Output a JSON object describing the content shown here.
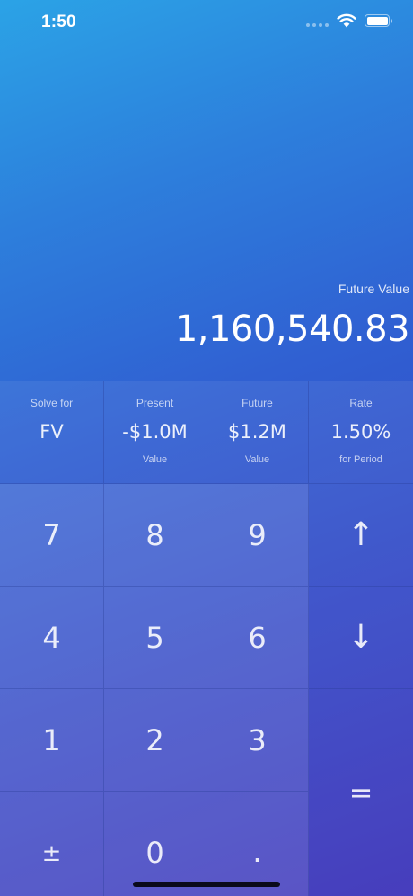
{
  "status_bar": {
    "time": "1:50",
    "icons": [
      "signal-icon",
      "wifi-icon",
      "battery-icon"
    ]
  },
  "display": {
    "label": "Future Value",
    "value": "1,160,540.83"
  },
  "variables": [
    {
      "top": "Solve for",
      "main": "FV",
      "bottom": ""
    },
    {
      "top": "Present",
      "main": "-$1.0M",
      "bottom": "Value"
    },
    {
      "top": "Future",
      "main": "$1.2M",
      "bottom": "Value"
    },
    {
      "top": "Rate",
      "main": "1.50%",
      "bottom": "for Period"
    }
  ],
  "keys": {
    "seven": "7",
    "eight": "8",
    "nine": "9",
    "four": "4",
    "five": "5",
    "six": "6",
    "one": "1",
    "two": "2",
    "three": "3",
    "plus_minus": "±",
    "zero": "0",
    "decimal": ".",
    "up": "↑",
    "down": "↓",
    "equals": "="
  },
  "colors": {
    "gradient_start": "#2ba3e6",
    "gradient_end": "#3a2fb8"
  }
}
